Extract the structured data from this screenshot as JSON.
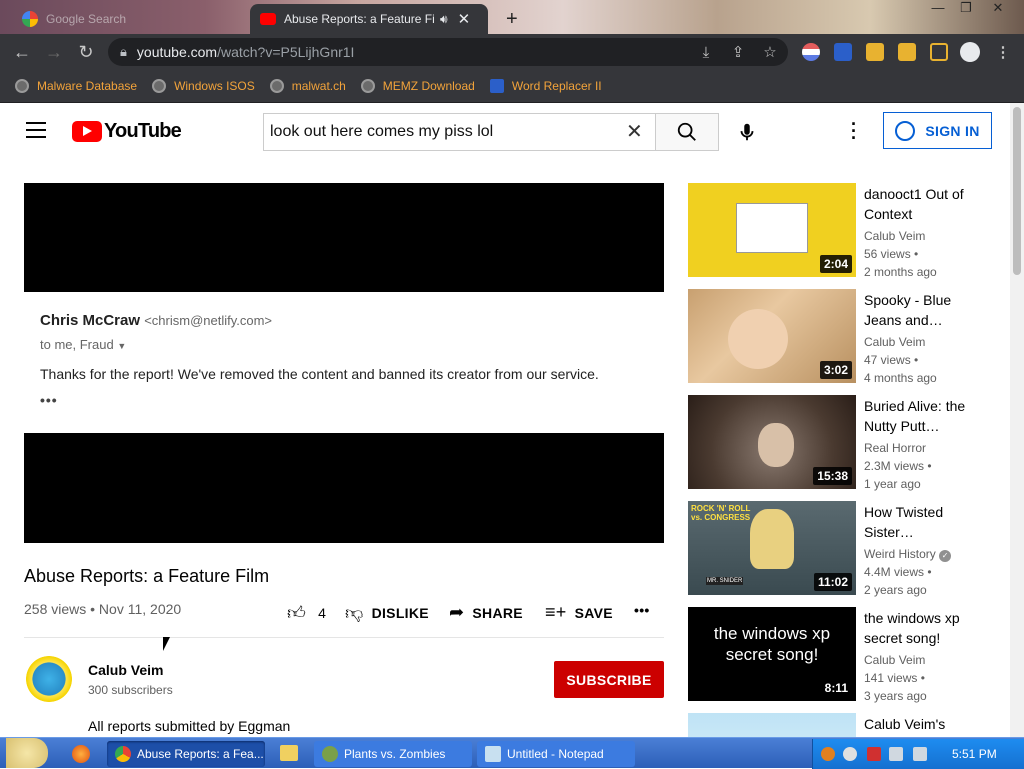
{
  "browser": {
    "tabs": [
      {
        "label": "Google Search",
        "prefix": "",
        "active": false
      },
      {
        "label": "Abuse Reports: a Feature Fil",
        "active": true
      }
    ],
    "url_host": "youtube.com",
    "url_path": "/watch?v=P5LijhGnr1I"
  },
  "bookmarks": [
    {
      "label": "Malware Database"
    },
    {
      "label": "Windows ISOS"
    },
    {
      "label": "malwat.ch"
    },
    {
      "label": "MEMZ Download"
    },
    {
      "label": "Word Replacer II"
    }
  ],
  "youtube": {
    "logo_text": "YouTube",
    "search_query": "look out here comes my piss lol",
    "signin_label": "SIGN IN"
  },
  "video": {
    "email": {
      "from_name": "Chris McCraw",
      "from_addr": "<chrism@netlify.com>",
      "to_line": "to me, Fraud",
      "message": "Thanks for the report!  We've removed the content and banned its creator from our service.",
      "more": "•••"
    },
    "title": "Abuse Reports: a Feature Film",
    "meta": "258 views • Nov 11, 2020",
    "likes": "4",
    "dislike_label": "DISLIKE",
    "share_label": "SHARE",
    "save_label": "SAVE",
    "more_label": "•••"
  },
  "channel": {
    "name": "Calub Veim",
    "subscribers": "300 subscribers",
    "subscribe_label": "SUBSCRIBE",
    "description": "All reports submitted by Eggman"
  },
  "related": [
    {
      "title": "danooct1 Out of Context",
      "channel": "Calub Veim",
      "views": "56 views •",
      "age": "2 months ago",
      "duration": "2:04"
    },
    {
      "title": "Spooky - Blue Jeans and…",
      "channel": "Calub Veim",
      "views": "47 views •",
      "age": "4 months ago",
      "duration": "3:02"
    },
    {
      "title": "Buried Alive: the Nutty Putt…",
      "channel": "Real Horror",
      "views": "2.3M views •",
      "age": "1 year ago",
      "duration": "15:38"
    },
    {
      "title": "How Twisted Sister…",
      "channel": "Weird History",
      "views": "4.4M views •",
      "age": "2 years ago",
      "duration": "11:02",
      "thumb_text": "ROCK 'N' ROLL vs. CONGRESS",
      "thumb_sub": "MR. SNIDER"
    },
    {
      "title": "the windows xp secret song!",
      "channel": "Calub Veim",
      "views": "141 views •",
      "age": "3 years ago",
      "duration": "8:11",
      "thumb_text": "the windows xp secret song!"
    },
    {
      "title": "Calub Veim's"
    }
  ],
  "taskbar": {
    "items": [
      {
        "label": "Abuse Reports: a Fea..."
      },
      {
        "label": "Plants vs. Zombies"
      },
      {
        "label": "Untitled - Notepad"
      }
    ],
    "clock": "5:51 PM"
  }
}
